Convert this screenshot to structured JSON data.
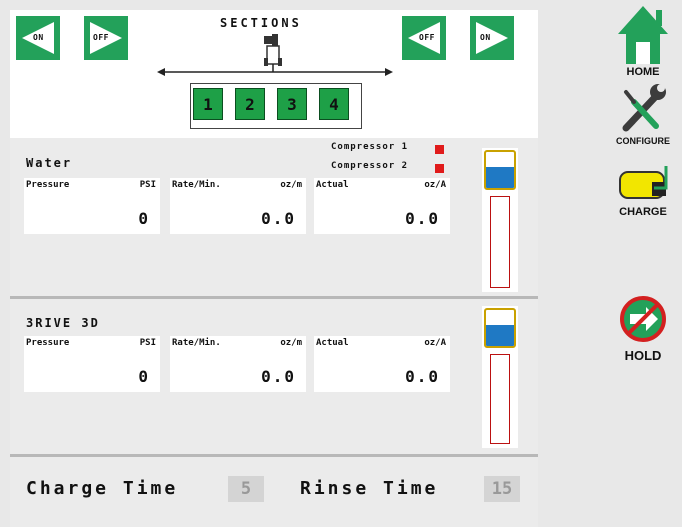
{
  "sections": {
    "title": "SECTIONS",
    "left_on": "ON",
    "left_off": "OFF",
    "right_off": "OFF",
    "right_on": "ON",
    "numbers": [
      "1",
      "2",
      "3",
      "4"
    ]
  },
  "products": [
    {
      "name": "Water",
      "pressure_label": "Pressure",
      "pressure_unit": "PSI",
      "pressure_value": "0",
      "rate_label": "Rate/Min.",
      "rate_unit": "oz/m",
      "rate_value": "0.0",
      "actual_label": "Actual",
      "actual_unit": "oz/A",
      "actual_value": "0.0",
      "tank_fill": 0.58,
      "level": 0
    },
    {
      "name": "3RIVE 3D",
      "pressure_label": "Pressure",
      "pressure_unit": "PSI",
      "pressure_value": "0",
      "rate_label": "Rate/Min.",
      "rate_unit": "oz/m",
      "rate_value": "0.0",
      "actual_label": "Actual",
      "actual_unit": "oz/A",
      "actual_value": "0.0",
      "tank_fill": 0.58,
      "level": 0
    }
  ],
  "compressors": [
    {
      "label": "Compressor 1",
      "status_color": "#e01b1b"
    },
    {
      "label": "Compressor 2",
      "status_color": "#e01b1b"
    }
  ],
  "footer": {
    "charge_label": "Charge Time",
    "charge_value": "5",
    "rinse_label": "Rinse Time",
    "rinse_value": "15"
  },
  "sidebar": {
    "home": {
      "label": "HOME",
      "icon": "house-icon"
    },
    "configure": {
      "label": "CONFIGURE",
      "icon": "wrench-screwdriver-icon"
    },
    "charge": {
      "label": "CHARGE",
      "icon": "tank-fill-icon"
    },
    "hold": {
      "label": "HOLD",
      "icon": "no-arrow-icon"
    }
  },
  "colors": {
    "accent_green": "#23a15a",
    "section_green": "#1ea047",
    "water_blue": "#1f79c4",
    "alarm_red": "#e01b1b"
  }
}
